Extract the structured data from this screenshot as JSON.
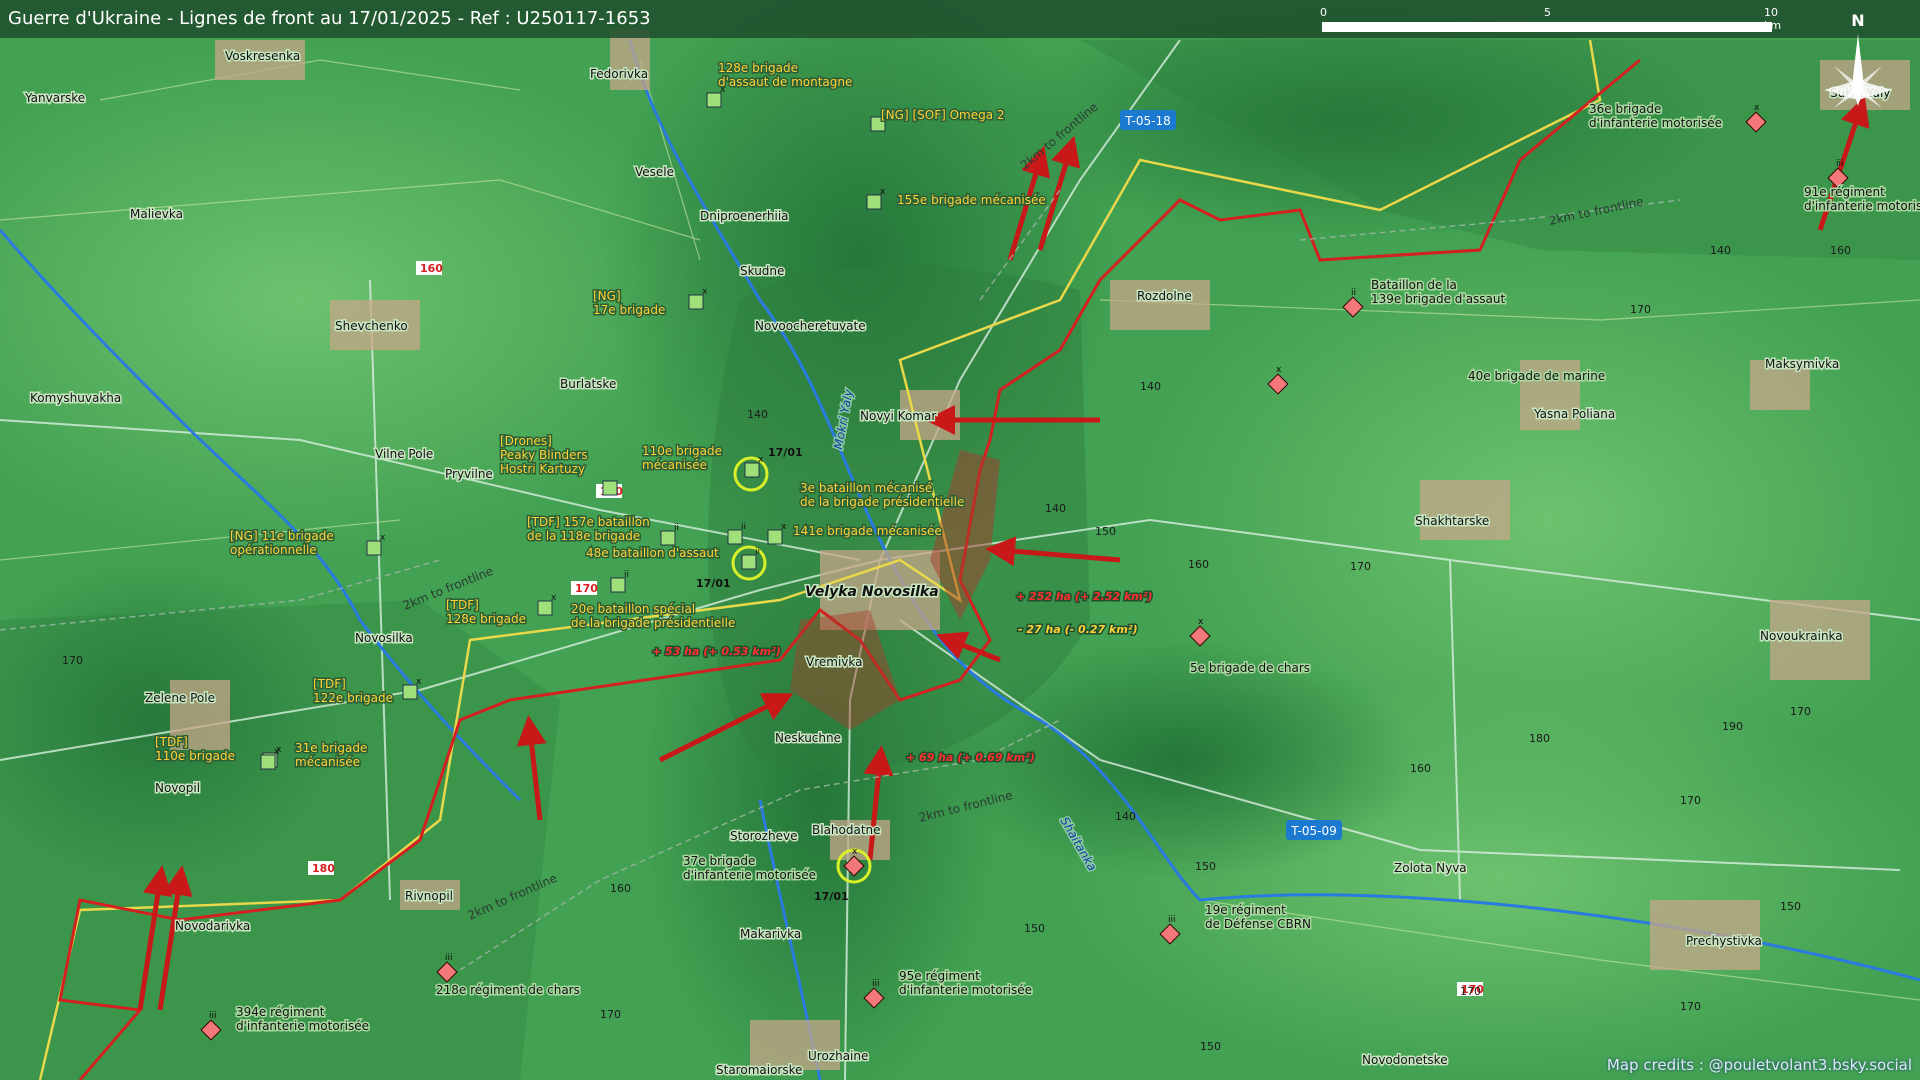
{
  "header": {
    "title": "Guerre d'Ukraine - Lignes de front au 17/01/2025 - Ref : U250117-1653"
  },
  "scale": {
    "labels": [
      "0",
      "5",
      "10 km"
    ]
  },
  "compass": {
    "label": "N"
  },
  "credits": "Map credits : @pouletvolant3.bsky.social",
  "colors": {
    "terrain": "#3f9a4f",
    "frontline": "#d42020",
    "old_line": "#e6d43a",
    "road_badge": "#1b7ad0",
    "ua_unit": "#9fe07a",
    "ru_unit": "#f2787a",
    "ua_label": "#ffd23a",
    "circle": "#d8f02a"
  },
  "places": [
    {
      "name": "Voskresenka"
    },
    {
      "name": "Yanvarske"
    },
    {
      "name": "Fedorivka"
    },
    {
      "name": "Malievka"
    },
    {
      "name": "Vesele"
    },
    {
      "name": "Dniproenerhiia"
    },
    {
      "name": "Skudne"
    },
    {
      "name": "Shevchenko"
    },
    {
      "name": "Novoocheretuvate"
    },
    {
      "name": "Komyshuvakha"
    },
    {
      "name": "Burlatske"
    },
    {
      "name": "Novyi Komar"
    },
    {
      "name": "Vilne Pole"
    },
    {
      "name": "Pryvilne"
    },
    {
      "name": "Velyka Novosilka"
    },
    {
      "name": "Novosilka"
    },
    {
      "name": "Vremivka"
    },
    {
      "name": "Zelene Pole"
    },
    {
      "name": "Neskuchne"
    },
    {
      "name": "Novopil"
    },
    {
      "name": "Storozheve"
    },
    {
      "name": "Blahodatne"
    },
    {
      "name": "Rivnopil"
    },
    {
      "name": "Novodarivka"
    },
    {
      "name": "Makarivka"
    },
    {
      "name": "Urozhaine"
    },
    {
      "name": "Staromaiorske"
    },
    {
      "name": "Rozdolne"
    },
    {
      "name": "Sukhi Yaly"
    },
    {
      "name": "Maksymivka"
    },
    {
      "name": "Yasna Poliana"
    },
    {
      "name": "Shakhtarske"
    },
    {
      "name": "Novoukrainka"
    },
    {
      "name": "Zolota Nyva"
    },
    {
      "name": "Prechystivka"
    },
    {
      "name": "Novodonetske"
    }
  ],
  "rivers": [
    {
      "name": "Mokri Yaly"
    },
    {
      "name": "Shaitanka"
    }
  ],
  "roads": [
    {
      "label": "T-05-18"
    },
    {
      "label": "T-05-09"
    }
  ],
  "frontline_notes": [
    {
      "text": "2km to frontline"
    },
    {
      "text": "2km to frontline"
    },
    {
      "text": "2km to frontline"
    },
    {
      "text": "2km to frontline"
    },
    {
      "text": "2km to frontline"
    }
  ],
  "elevations": [
    {
      "text": "160"
    },
    {
      "text": "170"
    },
    {
      "text": "170"
    },
    {
      "text": "170"
    },
    {
      "text": "180"
    },
    {
      "text": "170"
    },
    {
      "text": "140"
    },
    {
      "text": "140"
    },
    {
      "text": "150"
    },
    {
      "text": "160"
    },
    {
      "text": "170"
    },
    {
      "text": "140"
    },
    {
      "text": "170"
    },
    {
      "text": "140"
    },
    {
      "text": "180"
    },
    {
      "text": "190"
    },
    {
      "text": "160"
    },
    {
      "text": "150"
    },
    {
      "text": "170"
    },
    {
      "text": "170"
    },
    {
      "text": "150"
    },
    {
      "text": "150"
    },
    {
      "text": "170"
    },
    {
      "text": "140"
    },
    {
      "text": "160"
    },
    {
      "text": "150"
    },
    {
      "text": "170"
    },
    {
      "text": "160"
    },
    {
      "text": "170"
    }
  ],
  "gains": [
    {
      "text": "+ 252 ha (+ 2.52 km²)",
      "side": "ru"
    },
    {
      "text": "- 27 ha (- 0.27 km²)",
      "side": "ua"
    },
    {
      "text": "+ 53 ha (+ 0.53 km²)",
      "side": "ru"
    },
    {
      "text": "+ 69 ha (+ 0.69 km²)",
      "side": "ru"
    }
  ],
  "units_ua": [
    {
      "label": "128e brigade\nd'assaut de montagne",
      "echelon": "x"
    },
    {
      "label": "[NG] [SOF] Omega 2",
      "echelon": ""
    },
    {
      "label": "155e brigade mécanisée",
      "echelon": "x"
    },
    {
      "label": "[NG]\n17e brigade",
      "echelon": "x"
    },
    {
      "label": "[Drones]\nPeaky Blinders\nHostri Kartuzy",
      "echelon": ""
    },
    {
      "label": "110e brigade\nmécanisée",
      "echelon": "x",
      "date": "17/01"
    },
    {
      "label": "3e bataillon mécanisé\nde la brigade présidentielle",
      "echelon": "ii"
    },
    {
      "label": "[TDF] 157e bataillon\nde la 118e brigade",
      "echelon": "ii"
    },
    {
      "label": "141e brigade mécanisée",
      "echelon": "x"
    },
    {
      "label": "[NG] 11e brigade\nopérationnelle",
      "echelon": "x"
    },
    {
      "label": "48e bataillon d'assaut",
      "echelon": "ii",
      "date": "17/01"
    },
    {
      "label": "[TDF]\n128e brigade",
      "echelon": "x"
    },
    {
      "label": "20e bataillon spécial\nde la brigade présidentielle",
      "echelon": "ii"
    },
    {
      "label": "[TDF]\n122e brigade",
      "echelon": "x"
    },
    {
      "label": "[TDF]\n110e brigade",
      "echelon": "x"
    },
    {
      "label": "31e brigade\nmécanisée",
      "echelon": "x"
    }
  ],
  "units_ru": [
    {
      "label": "36e brigade\nd'infanterie motorisée",
      "echelon": "x"
    },
    {
      "label": "91e régiment\nd'infanterie motorisée",
      "echelon": "iii"
    },
    {
      "label": "Bataillon de la\n139e brigade d'assaut",
      "echelon": "ii"
    },
    {
      "label": "40e brigade de marine",
      "echelon": "x"
    },
    {
      "label": "5e brigade de chars",
      "echelon": "x"
    },
    {
      "label": "37e brigade\nd'infanterie motorisée",
      "echelon": "x",
      "date": "17/01"
    },
    {
      "label": "19e régiment\nde Défense CBRN",
      "echelon": "iii"
    },
    {
      "label": "95e régiment\nd'infanterie motorisée",
      "echelon": "iii"
    },
    {
      "label": "218e régiment de chars",
      "echelon": "iii"
    },
    {
      "label": "394e régiment\nd'infanterie motorisée",
      "echelon": "iii"
    }
  ]
}
